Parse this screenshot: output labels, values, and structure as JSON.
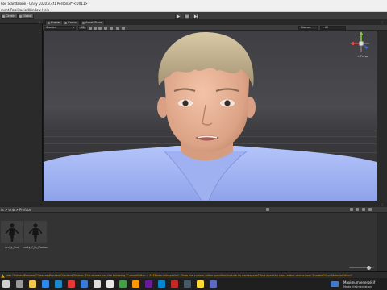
{
  "window": {
    "title": "hoc Standalone - Unity 2020.3.4f1 Personal* <DX11>"
  },
  "menu": [
    "ment",
    "Realizacion",
    "Window",
    "Help"
  ],
  "toolbar": {
    "center_label": "Center",
    "global_label": "Global"
  },
  "scene": {
    "tabs": [
      "Scene",
      "Game",
      "Asset Store"
    ],
    "shading_mode": "Shaded",
    "mode_2d": "2D",
    "gizmos_label": "Gizmos",
    "persp_label": "< Persp",
    "search_placeholder": "All"
  },
  "project": {
    "breadcrumb": "ts > unb > Prefabs",
    "assets": [
      {
        "name": "unity_flux",
        "icon": "character-prefab-icon"
      },
      {
        "name": "unity_f_la_fluxion",
        "icon": "character-prefab-icon"
      }
    ]
  },
  "console": {
    "status_message": "rder \"Hidden/Preview/GlassnessPreview Gradient Skybox: This shader has the following 'CustomEditor = ASEMaterialInspector'. Does the custom editor specified include its namespace? And does the class either derive from ShaderGUI or MaterialEditor?",
    "severity_color": "#e0a000"
  },
  "taskbar": {
    "notification_title": "Maximum energétif",
    "notification_sub": "Mode d'alimentation"
  },
  "colors": {
    "editor_bg": "#191919",
    "panel_bg": "#333333",
    "toolbar_bg": "#3c3c3c",
    "shirt": "#a6b8f5",
    "skin": "#e9b398",
    "hair": "#c9b896"
  }
}
